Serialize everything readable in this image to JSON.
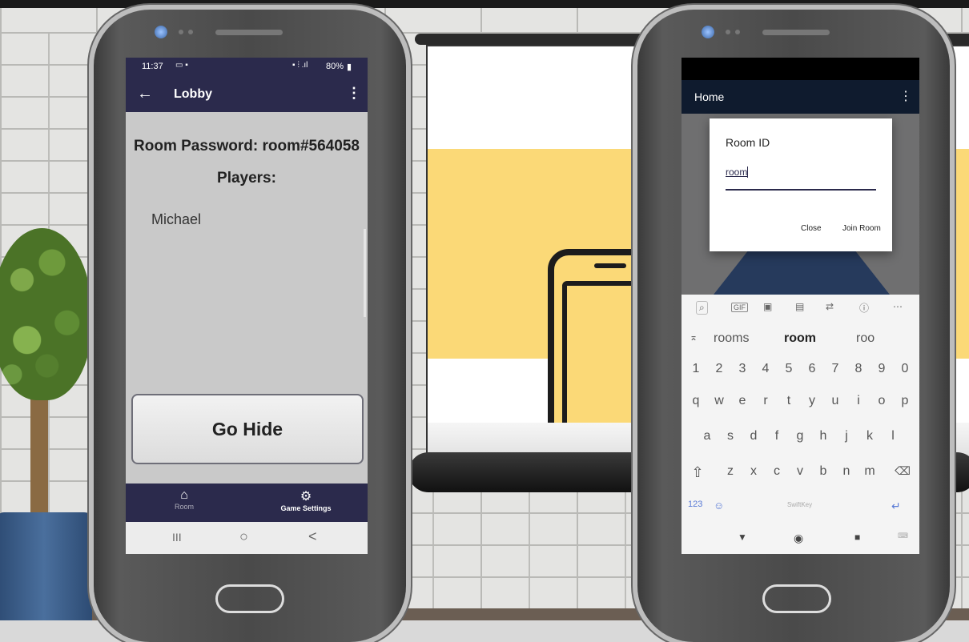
{
  "left_phone": {
    "status_time": "11:37",
    "status_right": "80%",
    "appbar_title": "Lobby",
    "room_password": "Room Password: room#564058",
    "players_label": "Players:",
    "players": [
      "Michael"
    ],
    "go_hide_label": "Go Hide",
    "nav": {
      "room": "Room",
      "settings": "Game Settings"
    },
    "sysnav": {
      "recent": "III",
      "home": "○",
      "back": "<"
    }
  },
  "right_phone": {
    "appbar_title": "Home",
    "dialog": {
      "title": "Room ID",
      "input_value": "room",
      "close_label": "Close",
      "join_label": "Join Room"
    },
    "keyboard": {
      "suggestions": [
        "rooms",
        "room",
        "roo"
      ],
      "number_row": [
        "1",
        "2",
        "3",
        "4",
        "5",
        "6",
        "7",
        "8",
        "9",
        "0"
      ],
      "row1": [
        "q",
        "w",
        "e",
        "r",
        "t",
        "y",
        "u",
        "i",
        "o",
        "p"
      ],
      "row2": [
        "a",
        "s",
        "d",
        "f",
        "g",
        "h",
        "j",
        "k",
        "l"
      ],
      "row3": [
        "z",
        "x",
        "c",
        "v",
        "b",
        "n",
        "m"
      ],
      "mode_key": "123",
      "space_label": "SwiftKey",
      "toolbar_icons": [
        "search-icon",
        "gif-icon",
        "sticker-icon",
        "clipboard-icon",
        "translate-icon",
        "info-icon",
        "more-icon"
      ]
    }
  }
}
